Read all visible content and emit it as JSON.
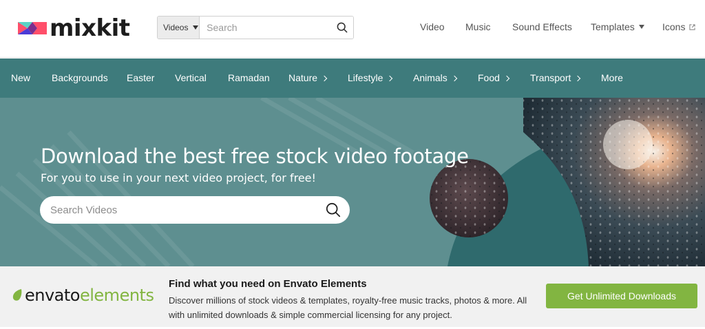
{
  "brand": {
    "logo_text": "mixkit",
    "colors": {
      "accent": "#3e7b7c",
      "hero_bg": "#5e8f90",
      "envato_green": "#82b541"
    }
  },
  "header": {
    "search": {
      "category": "Videos",
      "placeholder": "Search"
    },
    "nav": [
      {
        "label": "Video",
        "dropdown": false,
        "external": false
      },
      {
        "label": "Music",
        "dropdown": false,
        "external": false
      },
      {
        "label": "Sound Effects",
        "dropdown": false,
        "external": false
      },
      {
        "label": "Templates",
        "dropdown": true,
        "external": false
      },
      {
        "label": "Icons",
        "dropdown": false,
        "external": true
      }
    ]
  },
  "categories": [
    {
      "label": "New",
      "chevron": false
    },
    {
      "label": "Backgrounds",
      "chevron": false
    },
    {
      "label": "Easter",
      "chevron": false
    },
    {
      "label": "Vertical",
      "chevron": false
    },
    {
      "label": "Ramadan",
      "chevron": false
    },
    {
      "label": "Nature",
      "chevron": true
    },
    {
      "label": "Lifestyle",
      "chevron": true
    },
    {
      "label": "Animals",
      "chevron": true
    },
    {
      "label": "Food",
      "chevron": true
    },
    {
      "label": "Transport",
      "chevron": true
    },
    {
      "label": "More",
      "chevron": false
    }
  ],
  "hero": {
    "title": "Download the best free stock video footage",
    "subtitle": "For you to use in your next video project, for free!",
    "search_placeholder": "Search Videos"
  },
  "envato": {
    "logo_part1": "envato",
    "logo_part2": "elements",
    "title": "Find what you need on Envato Elements",
    "description": "Discover millions of stock videos & templates, royalty-free music tracks, photos & more. All with unlimited downloads & simple commercial licensing for any project.",
    "cta": "Get Unlimited Downloads"
  }
}
